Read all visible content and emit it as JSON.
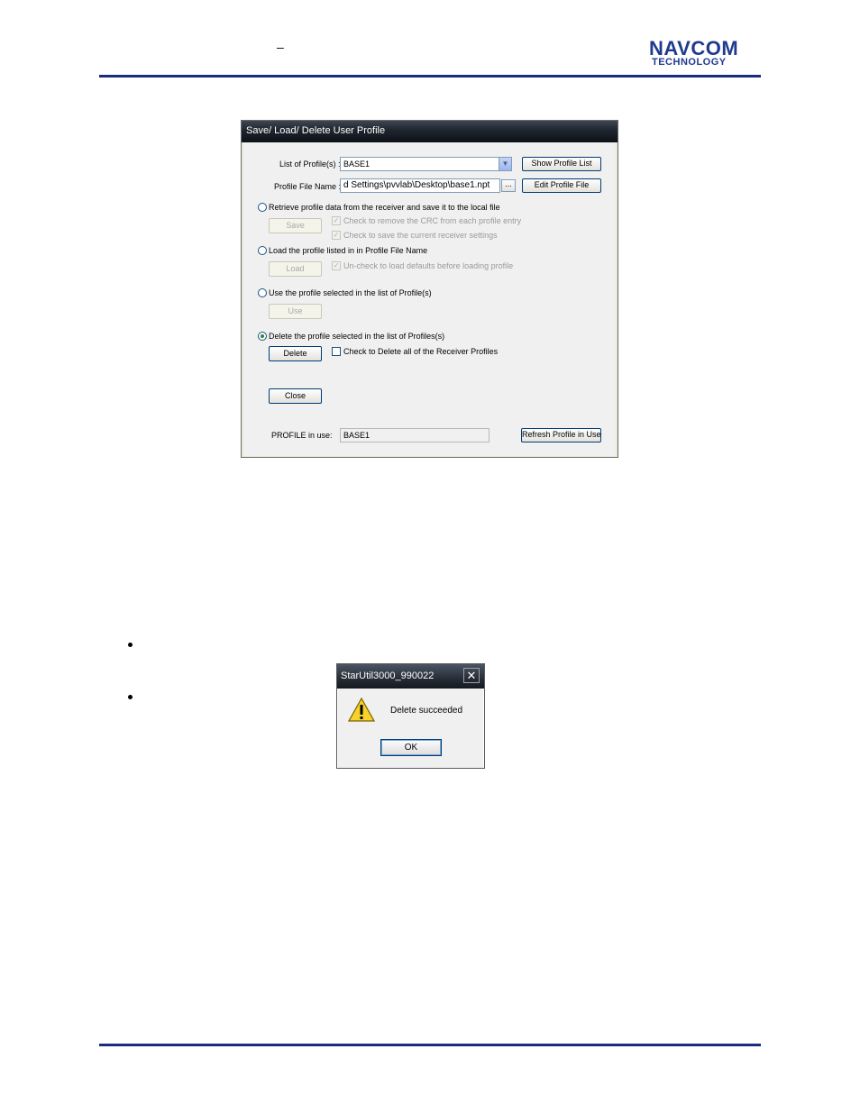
{
  "header": {
    "dash": "–",
    "logo_top": "NAVCOM",
    "logo_bottom": "TECHNOLOGY"
  },
  "dialog": {
    "title": "Save/ Load/ Delete User Profile",
    "list_label": "List of Profile(s) :",
    "list_value": "BASE1",
    "file_label": "Profile File Name :",
    "file_value": "d Settings\\pvvlab\\Desktop\\base1.npt",
    "browse_label": "...",
    "show_list_button": "Show Profile List",
    "edit_file_button": "Edit Profile File",
    "opt_retrieve": "Retrieve profile data from the receiver and save it to the local file",
    "save_button": "Save",
    "chk_remove_crc": "Check to remove the CRC from each profile entry",
    "chk_save_current": "Check to save the current receiver settings",
    "opt_load": "Load the profile listed in in Profile File Name",
    "load_button": "Load",
    "chk_uncheck_defaults": "Un-check to load defaults before loading profile",
    "opt_use": "Use the profile selected in the list of Profile(s)",
    "use_button": "Use",
    "opt_delete": "Delete the profile selected in the list of Profiles(s)",
    "delete_button": "Delete",
    "chk_delete_all": "Check to Delete all of the Receiver Profiles",
    "close_button": "Close",
    "in_use_label": "PROFILE in use:",
    "in_use_value": "BASE1",
    "refresh_button": "Refresh Profile in Use",
    "selected_option": "delete"
  },
  "msgbox": {
    "title": "StarUtil3000_990022",
    "close": "✕",
    "message": "Delete succeeded",
    "ok_button": "OK",
    "icon": "warning-icon"
  }
}
